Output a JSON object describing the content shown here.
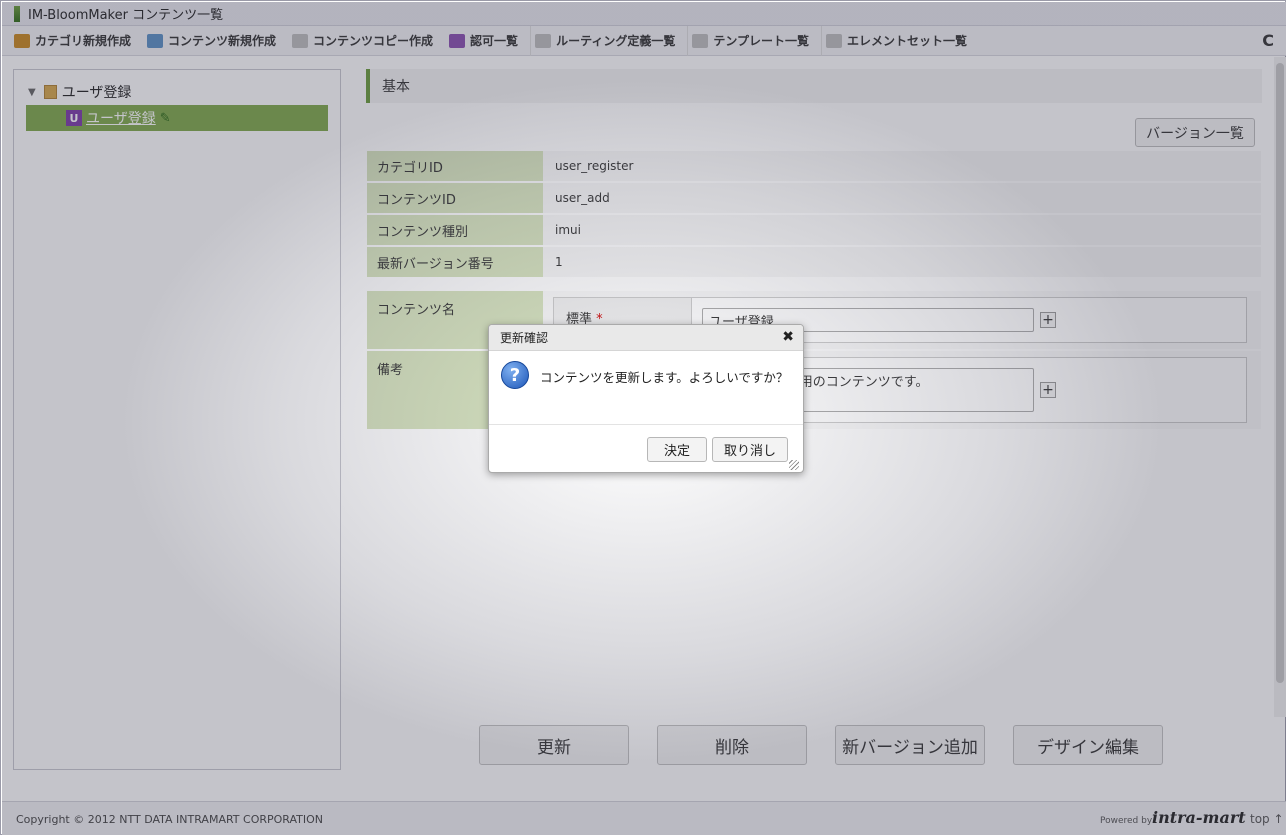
{
  "window": {
    "title": "IM-BloomMaker コンテンツ一覧"
  },
  "toolbar": {
    "items": [
      {
        "label": "カテゴリ新規作成",
        "icon": "category-add-icon",
        "color": "#c9881f"
      },
      {
        "label": "コンテンツ新規作成",
        "icon": "content-add-icon",
        "color": "#5a8fc4"
      },
      {
        "label": "コンテンツコピー作成",
        "icon": "content-copy-icon",
        "color": "#8a8a8a"
      },
      {
        "label": "認可一覧",
        "icon": "authorization-icon",
        "color": "#8a4fb0"
      },
      {
        "label": "ルーティング定義一覧",
        "icon": "list-icon",
        "color": "#9a9a9a"
      },
      {
        "label": "テンプレート一覧",
        "icon": "list-icon",
        "color": "#9a9a9a"
      },
      {
        "label": "エレメントセット一覧",
        "icon": "list-icon",
        "color": "#9a9a9a"
      }
    ],
    "refresh_icon": "refresh-icon"
  },
  "tree": {
    "root_label": "ユーザ登録",
    "selected_label": "ユーザ登録",
    "selected_badge": "U"
  },
  "section": {
    "title": "基本"
  },
  "version_button": "バージョン一覧",
  "info": [
    {
      "key": "カテゴリID",
      "value": "user_register"
    },
    {
      "key": "コンテンツID",
      "value": "user_add"
    },
    {
      "key": "コンテンツ種別",
      "value": "imui"
    },
    {
      "key": "最新バージョン番号",
      "value": "1"
    }
  ],
  "form": {
    "name_label": "コンテンツ名",
    "lang_label": "標準",
    "required_mark": "*",
    "name_value": "ユーザ登録",
    "memo_label": "備考",
    "memo_value": "ユーザ登録画面用のコンテンツです。",
    "plus": "+"
  },
  "buttons": [
    "更新",
    "削除",
    "新バージョン追加",
    "デザイン編集"
  ],
  "footer": {
    "copyright": "Copyright © 2012 NTT DATA INTRAMART CORPORATION",
    "powered": "Powered by",
    "brand": "intra-mart",
    "top": "top ↑"
  },
  "dialog": {
    "title": "更新確認",
    "close": "✖",
    "message": "コンテンツを更新します。よろしいですか？",
    "ok": "決定",
    "cancel": "取り消し"
  }
}
